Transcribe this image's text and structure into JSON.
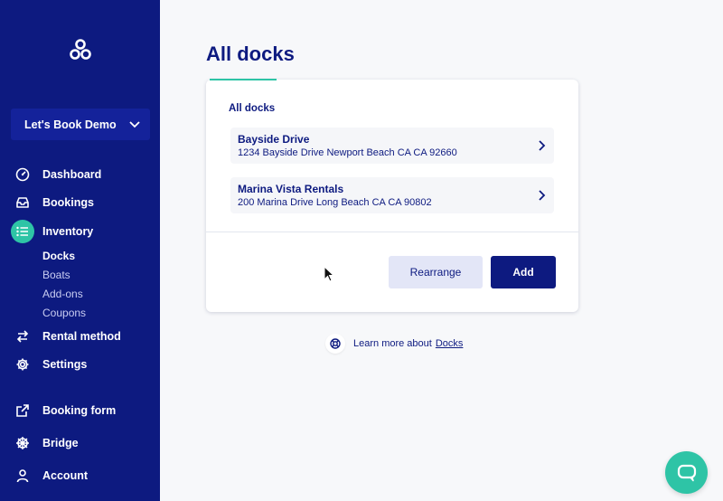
{
  "workspace": {
    "name": "Let's Book Demo"
  },
  "nav": {
    "dashboard": "Dashboard",
    "bookings": "Bookings",
    "inventory": "Inventory",
    "inventory_sub": [
      "Docks",
      "Boats",
      "Add-ons",
      "Coupons"
    ],
    "rental_method": "Rental method",
    "settings": "Settings",
    "booking_form": "Booking form",
    "bridge": "Bridge",
    "account": "Account"
  },
  "main": {
    "title": "All docks",
    "section_label": "All docks",
    "docks": [
      {
        "name": "Bayside Drive",
        "address": "1234 Bayside Drive Newport Beach CA CA 92660"
      },
      {
        "name": "Marina Vista Rentals",
        "address": "200 Marina Drive Long Beach CA CA 90802"
      }
    ],
    "rearrange_label": "Rearrange",
    "add_label": "Add",
    "learn_more_text": "Learn more about",
    "learn_more_link": "Docks"
  },
  "colors": {
    "primary": "#0d1a80",
    "accent": "#2ec4a6",
    "background": "#f7f8fa"
  },
  "icons": [
    "logo-icon",
    "chevron-down-icon",
    "dashboard-icon",
    "inbox-icon",
    "list-icon",
    "swap-icon",
    "gear-icon",
    "external-link-icon",
    "helm-icon",
    "user-icon",
    "chevron-right-icon",
    "lifebuoy-icon",
    "chat-icon"
  ]
}
